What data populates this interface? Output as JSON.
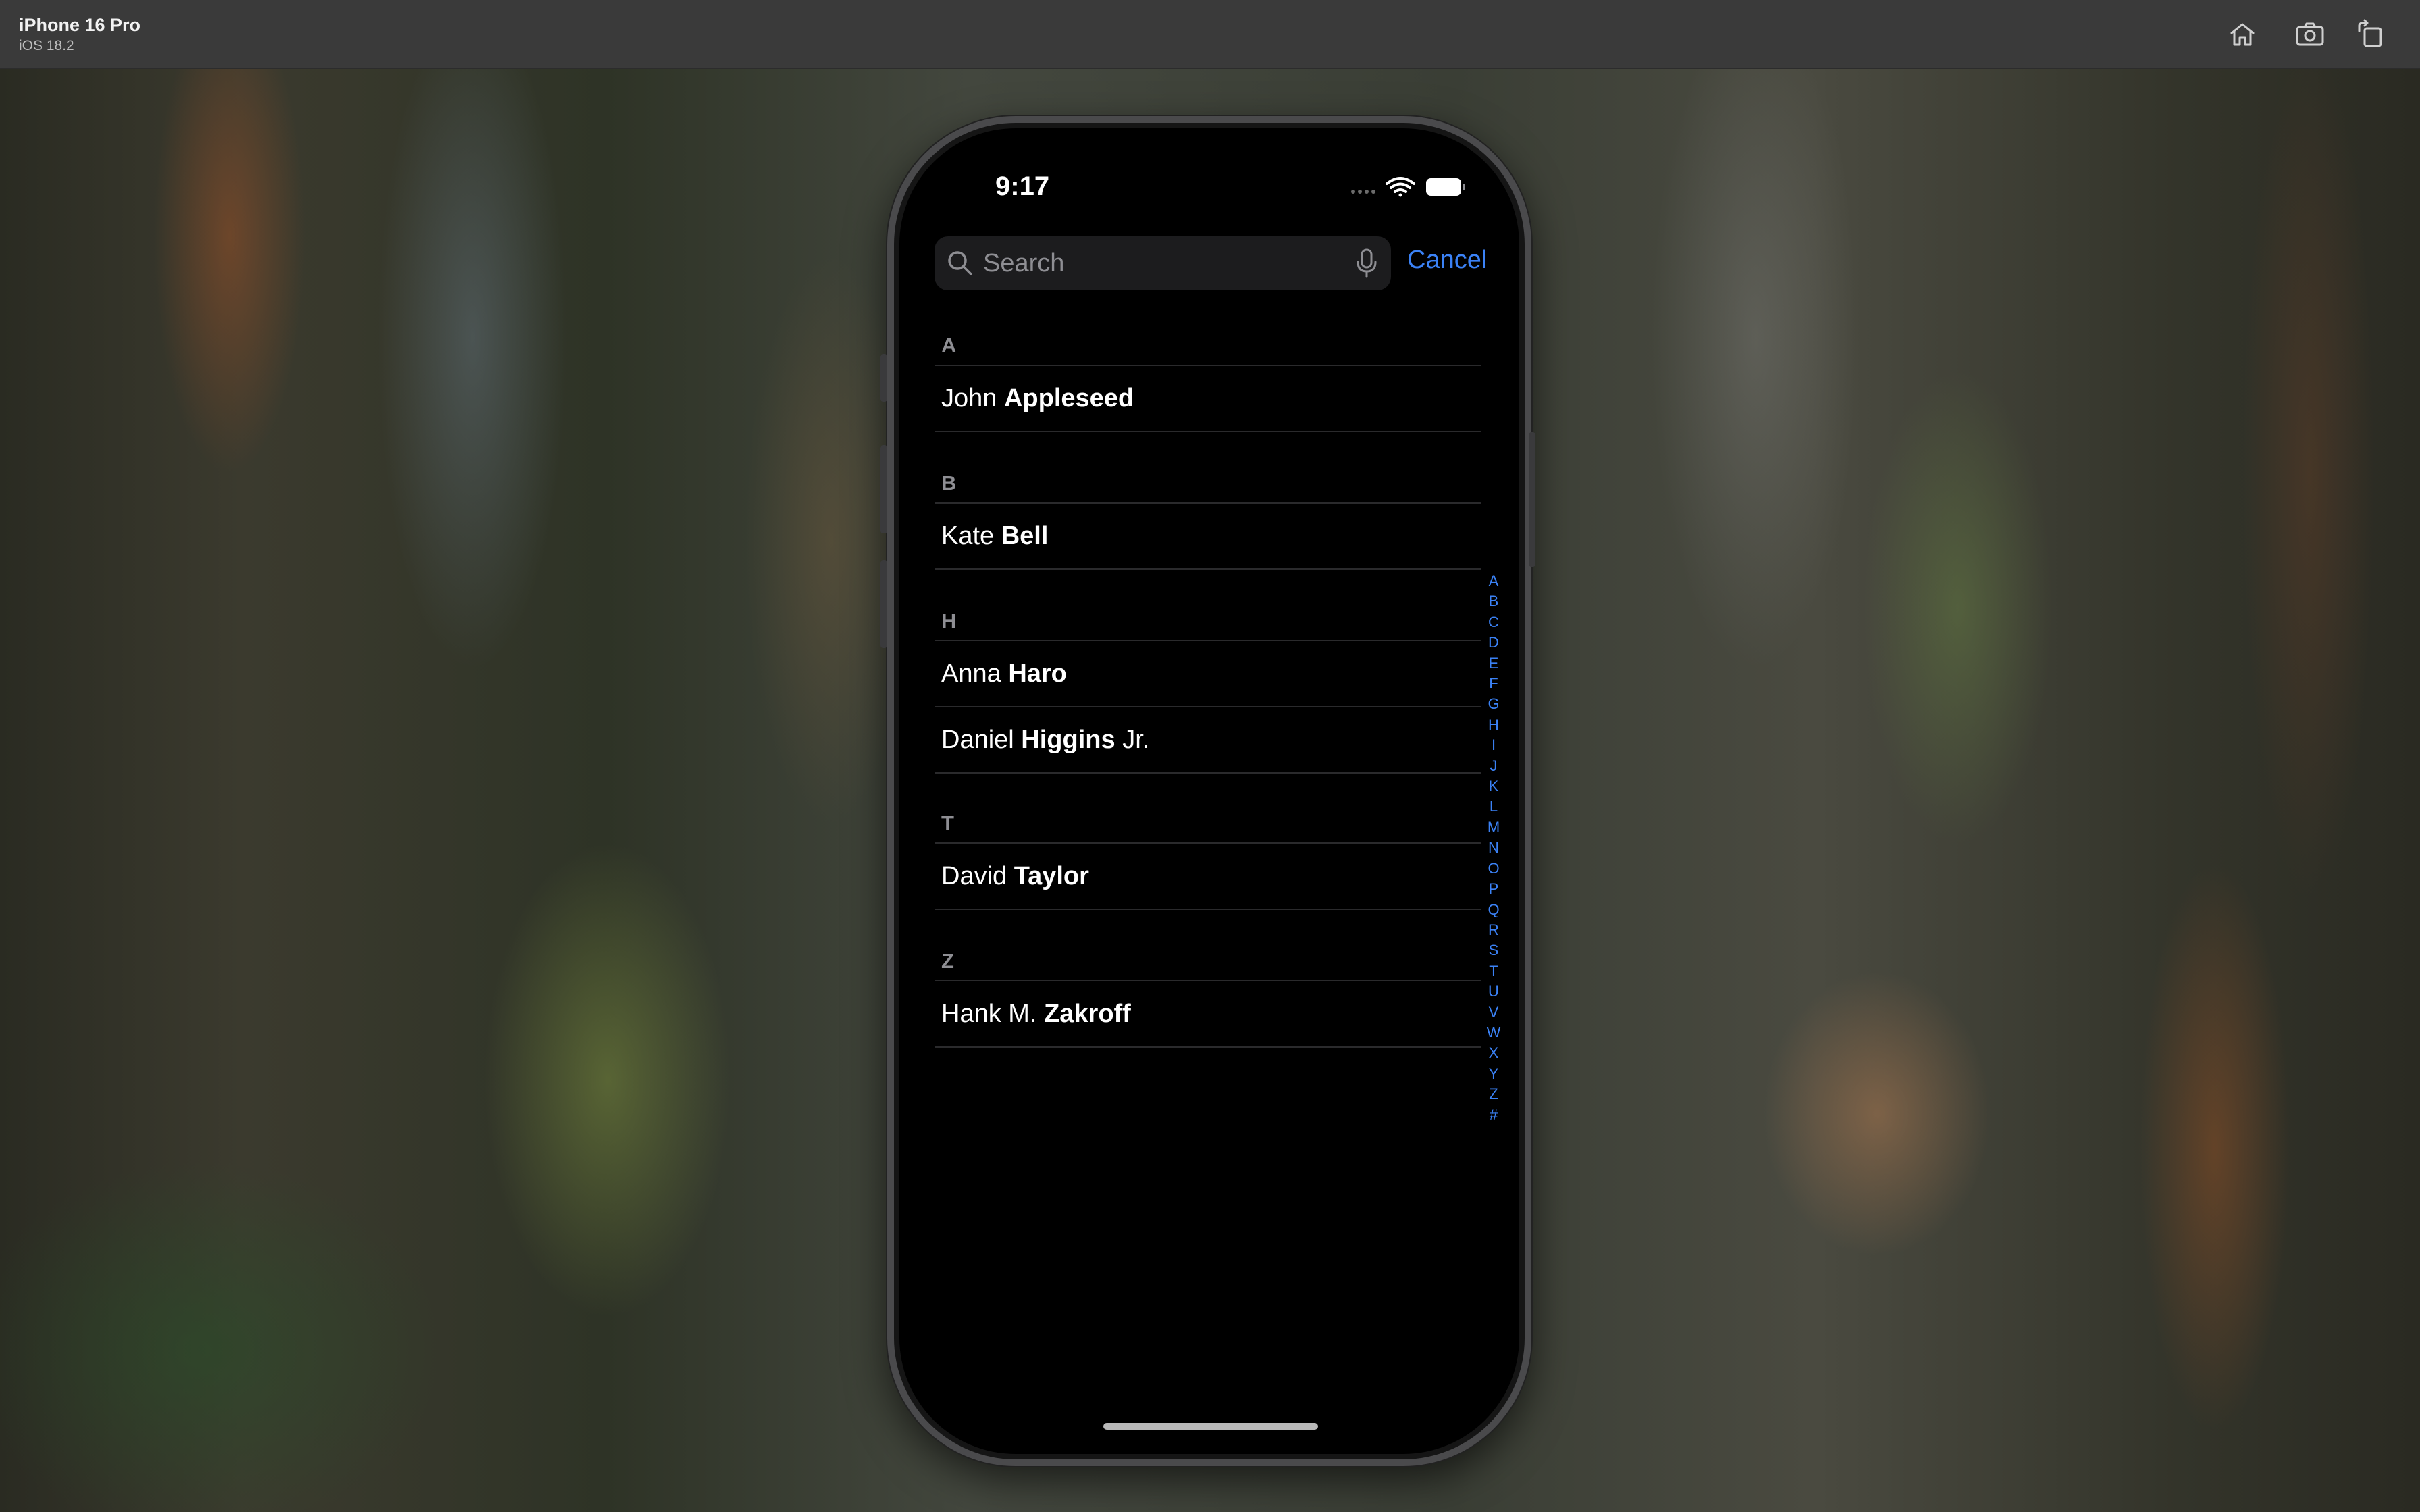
{
  "window": {
    "device_name": "iPhone 16 Pro",
    "os_version": "iOS 18.2",
    "toolbar_icons": [
      "home-icon",
      "screenshot-icon",
      "rotate-icon"
    ]
  },
  "status_bar": {
    "time": "9:17",
    "icons": [
      "cellular-signal-icon",
      "wifi-icon",
      "battery-icon"
    ]
  },
  "search": {
    "placeholder": "Search",
    "value": "",
    "cancel_label": "Cancel"
  },
  "contacts": {
    "sections": [
      {
        "letter": "A",
        "rows": [
          {
            "first": "John",
            "last": "Appleseed",
            "suffix": ""
          }
        ]
      },
      {
        "letter": "B",
        "rows": [
          {
            "first": "Kate",
            "last": "Bell",
            "suffix": ""
          }
        ]
      },
      {
        "letter": "H",
        "rows": [
          {
            "first": "Anna",
            "last": "Haro",
            "suffix": ""
          },
          {
            "first": "Daniel",
            "last": "Higgins",
            "suffix": "Jr."
          }
        ]
      },
      {
        "letter": "T",
        "rows": [
          {
            "first": "David",
            "last": "Taylor",
            "suffix": ""
          }
        ]
      },
      {
        "letter": "Z",
        "rows": [
          {
            "first": "Hank M.",
            "last": "Zakroff",
            "suffix": ""
          }
        ]
      }
    ]
  },
  "index_letters": [
    "A",
    "B",
    "C",
    "D",
    "E",
    "F",
    "G",
    "H",
    "I",
    "J",
    "K",
    "L",
    "M",
    "N",
    "O",
    "P",
    "Q",
    "R",
    "S",
    "T",
    "U",
    "V",
    "W",
    "X",
    "Y",
    "Z",
    "#"
  ],
  "colors": {
    "accent": "#3b82f6",
    "background": "#000000",
    "search_field": "#1c1c1e",
    "section_header": "#8e8e93"
  }
}
